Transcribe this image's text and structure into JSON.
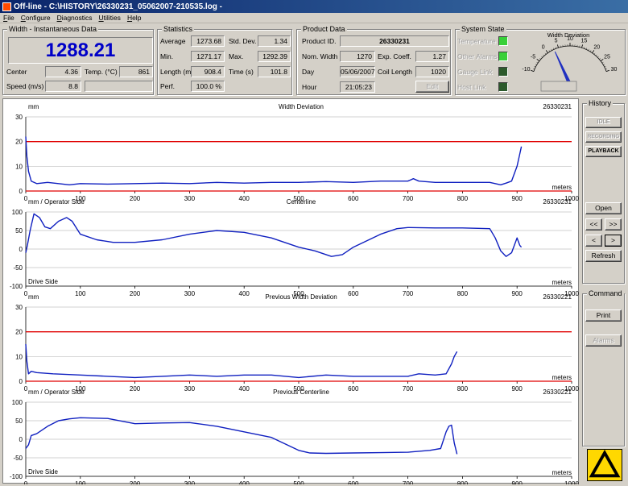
{
  "window": {
    "title": "Off-line - C:\\HISTORY\\26330231_05062007-210535.log -"
  },
  "menu": [
    {
      "pre": "",
      "u": "F",
      "post": "ile"
    },
    {
      "pre": "",
      "u": "C",
      "post": "onfigure"
    },
    {
      "pre": "",
      "u": "D",
      "post": "iagnostics"
    },
    {
      "pre": "",
      "u": "U",
      "post": "tilities"
    },
    {
      "pre": "",
      "u": "H",
      "post": "elp"
    }
  ],
  "width_group": {
    "title": "Width - Instantaneous Data",
    "big_value": "1288.21",
    "center_label": "Center",
    "center_value": "4.36",
    "temp_label": "Temp. (°C)",
    "temp_value": "861",
    "speed_label": "Speed (m/s)",
    "speed_value": "8.8",
    "extra_value": ""
  },
  "statistics": {
    "title": "Statistics",
    "average_label": "Average",
    "average_value": "1273.68",
    "stddev_label": "Std. Dev.",
    "stddev_value": "1.34",
    "min_label": "Min.",
    "min_value": "1271.17",
    "max_label": "Max.",
    "max_value": "1292.39",
    "length_label": "Length (m)",
    "length_value": "908.4",
    "time_label": "Time (s)",
    "time_value": "101.8",
    "perf_label": "Perf.",
    "perf_value": "100.0 %"
  },
  "product": {
    "title": "Product Data",
    "id_label": "Product ID.",
    "id_value": "26330231",
    "nomwidth_label": "Nom. Width",
    "nomwidth_value": "1270",
    "expcoeff_label": "Exp. Coeff.",
    "expcoeff_value": "1.27",
    "day_label": "Day",
    "day_value": "05/06/2007",
    "coil_label": "Coil Length",
    "coil_value": "1020",
    "hour_label": "Hour",
    "hour_value": "21:05:23",
    "edit_label": "Edit"
  },
  "system_state": {
    "title": "System State",
    "items": [
      {
        "label": "Temperature",
        "color": "#38d038"
      },
      {
        "label": "Other Alarms",
        "color": "#38d038"
      },
      {
        "label": "Gauge Link",
        "color": "#2c5a2c"
      },
      {
        "label": "Host Link",
        "color": "#2c5a2c"
      }
    ],
    "gauge": {
      "title": "Width Deviation",
      "ticks": [
        "-10",
        "-5",
        "0",
        "5",
        "10",
        "15",
        "20",
        "25",
        "30"
      ],
      "value": 3
    }
  },
  "history": {
    "title": "History",
    "idle_label": "IDLE",
    "recording_label": "RECORDING",
    "playback_label": "PLAYBACK",
    "open_label": "Open",
    "first_label": "<<",
    "last_label": ">>",
    "prev_label": "<",
    "next_label": ">",
    "refresh_label": "Refresh"
  },
  "command": {
    "title": "Command",
    "print_label": "Print",
    "alarms_label": "Alarms"
  },
  "charts": [
    {
      "title": "Width Deviation",
      "unit": "mm",
      "id": "26330231",
      "top_left": "",
      "bottom_left": ""
    },
    {
      "title": "Centerline",
      "unit": "",
      "id": "26330231",
      "top_left": "mm / Operator Side",
      "bottom_left": "Drive Side"
    },
    {
      "title": "Previous Width Deviation",
      "unit": "mm",
      "id": "26330221",
      "top_left": "",
      "bottom_left": ""
    },
    {
      "title": "Previous Centerline",
      "unit": "",
      "id": "26330221",
      "top_left": "mm / Operator Side",
      "bottom_left": "Drive Side"
    }
  ],
  "chart_data": [
    {
      "type": "line",
      "title": "Width Deviation",
      "xlabel": "meters",
      "ylabel": "mm",
      "xlim": [
        0,
        1000
      ],
      "ylim": [
        0,
        30
      ],
      "xticks": [
        "0",
        "100",
        "200",
        "300",
        "400",
        "500",
        "600",
        "700",
        "800",
        "900",
        "1000"
      ],
      "yticks": [
        "0",
        "10",
        "20",
        "30"
      ],
      "limit_lines": [
        0,
        20
      ],
      "series": [
        {
          "x": [
            0,
            2,
            5,
            10,
            20,
            40,
            60,
            80,
            100,
            150,
            200,
            250,
            300,
            350,
            400,
            450,
            500,
            550,
            600,
            650,
            700,
            710,
            720,
            750,
            800,
            850,
            870,
            880,
            890,
            900,
            905,
            908
          ],
          "y": [
            22,
            14,
            8,
            4,
            3,
            3.5,
            3,
            2.5,
            3,
            2.8,
            3,
            3.2,
            3,
            3.5,
            3.2,
            3.5,
            3.5,
            3.8,
            3.5,
            4,
            4,
            5,
            4,
            3.5,
            3.5,
            3.5,
            2.5,
            3.2,
            4,
            10,
            15,
            18
          ]
        }
      ]
    },
    {
      "type": "line",
      "title": "Centerline",
      "xlabel": "meters",
      "ylabel": "mm / Operator Side",
      "xlim": [
        0,
        1000
      ],
      "ylim": [
        -100,
        100
      ],
      "xticks": [
        "0",
        "100",
        "200",
        "300",
        "400",
        "500",
        "600",
        "700",
        "800",
        "900",
        "1000"
      ],
      "yticks": [
        "-100",
        "-50",
        "0",
        "50",
        "100"
      ],
      "series": [
        {
          "x": [
            0,
            3,
            8,
            15,
            25,
            35,
            45,
            60,
            75,
            85,
            100,
            130,
            160,
            200,
            250,
            300,
            350,
            400,
            450,
            500,
            530,
            560,
            580,
            600,
            650,
            680,
            700,
            750,
            800,
            850,
            860,
            870,
            880,
            890,
            900,
            905,
            908
          ],
          "y": [
            -10,
            10,
            50,
            95,
            85,
            60,
            55,
            75,
            85,
            75,
            40,
            25,
            18,
            18,
            25,
            40,
            50,
            45,
            30,
            5,
            -5,
            -20,
            -15,
            5,
            40,
            55,
            58,
            57,
            57,
            55,
            30,
            -5,
            -20,
            -10,
            30,
            10,
            5
          ]
        }
      ]
    },
    {
      "type": "line",
      "title": "Previous Width Deviation",
      "xlabel": "meters",
      "ylabel": "mm",
      "xlim": [
        0,
        1000
      ],
      "ylim": [
        0,
        30
      ],
      "xticks": [
        "0",
        "100",
        "200",
        "300",
        "400",
        "500",
        "600",
        "700",
        "800",
        "900",
        "1000"
      ],
      "yticks": [
        "0",
        "10",
        "20",
        "30"
      ],
      "limit_lines": [
        0,
        20
      ],
      "series": [
        {
          "x": [
            0,
            2,
            5,
            10,
            20,
            50,
            100,
            150,
            200,
            250,
            300,
            350,
            400,
            450,
            500,
            550,
            600,
            650,
            700,
            720,
            750,
            770,
            780,
            785,
            790
          ],
          "y": [
            15,
            8,
            3,
            4,
            3.5,
            3,
            2.5,
            2,
            1.5,
            2,
            2.5,
            2,
            2.5,
            2.5,
            1.5,
            2.5,
            2,
            2,
            2,
            3,
            2.5,
            3,
            7,
            10,
            12
          ]
        }
      ]
    },
    {
      "type": "line",
      "title": "Previous Centerline",
      "xlabel": "meters",
      "ylabel": "mm / Operator Side",
      "xlim": [
        0,
        1000
      ],
      "ylim": [
        -100,
        100
      ],
      "xticks": [
        "0",
        "100",
        "200",
        "300",
        "400",
        "500",
        "600",
        "700",
        "800",
        "900",
        "1000"
      ],
      "yticks": [
        "-100",
        "-50",
        "0",
        "50",
        "100"
      ],
      "series": [
        {
          "x": [
            0,
            5,
            10,
            20,
            40,
            60,
            80,
            100,
            150,
            200,
            250,
            300,
            350,
            400,
            450,
            500,
            520,
            550,
            600,
            650,
            700,
            740,
            760,
            770,
            775,
            780,
            785,
            790
          ],
          "y": [
            -25,
            -15,
            10,
            15,
            35,
            50,
            55,
            58,
            56,
            42,
            44,
            45,
            35,
            20,
            5,
            -30,
            -37,
            -38,
            -37,
            -36,
            -35,
            -30,
            -25,
            20,
            35,
            38,
            -10,
            -40
          ]
        }
      ]
    }
  ]
}
